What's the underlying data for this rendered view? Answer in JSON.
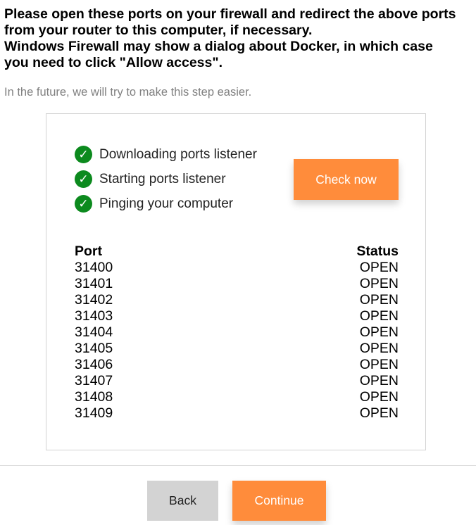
{
  "instructions": {
    "line1": "Please open these ports on your firewall and redirect the above ports",
    "line2": "from your router to this computer, if necessary.",
    "line3": "Windows Firewall may show a dialog about Docker, in which case",
    "line4": "you need to click \"Allow access\"."
  },
  "note": "In the future, we will try to make this step easier.",
  "steps": [
    {
      "icon": "check-icon",
      "glyph": "✓",
      "label": "Downloading ports listener"
    },
    {
      "icon": "check-icon",
      "glyph": "✓",
      "label": "Starting ports listener"
    },
    {
      "icon": "check-icon",
      "glyph": "✓",
      "label": "Pinging your computer"
    }
  ],
  "check_button": "Check now",
  "table": {
    "headers": {
      "port": "Port",
      "status": "Status"
    },
    "rows": [
      {
        "port": "31400",
        "status": "OPEN"
      },
      {
        "port": "31401",
        "status": "OPEN"
      },
      {
        "port": "31402",
        "status": "OPEN"
      },
      {
        "port": "31403",
        "status": "OPEN"
      },
      {
        "port": "31404",
        "status": "OPEN"
      },
      {
        "port": "31405",
        "status": "OPEN"
      },
      {
        "port": "31406",
        "status": "OPEN"
      },
      {
        "port": "31407",
        "status": "OPEN"
      },
      {
        "port": "31408",
        "status": "OPEN"
      },
      {
        "port": "31409",
        "status": "OPEN"
      }
    ]
  },
  "footer": {
    "back_label": "Back",
    "continue_label": "Continue"
  },
  "colors": {
    "accent": "#ff8c3b",
    "check_green": "#0c8a1e",
    "note_gray": "#808080",
    "back_gray": "#d3d3d3"
  }
}
